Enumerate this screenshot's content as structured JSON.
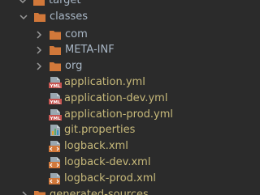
{
  "tree": {
    "target_label": "target",
    "classes_label": "classes",
    "com_label": "com",
    "meta_inf_label": "META-INF",
    "org_label": "org",
    "application_yml": "application.yml",
    "application_dev_yml": "application-dev.yml",
    "application_prod_yml": "application-prod.yml",
    "git_properties": "git.properties",
    "logback_xml": "logback.xml",
    "logback_dev_xml": "logback-dev.xml",
    "logback_prod_xml": "logback-prod.xml",
    "generated_sources_label": "generated-sources",
    "yml_badge": "YML"
  },
  "colors": {
    "background": "#2b2b2b",
    "folder": "#d1783a",
    "text": "#c7b97a",
    "chevron": "#9a9a9a"
  },
  "icons": {
    "chevron_down": "chevron-down-icon",
    "chevron_right": "chevron-right-icon",
    "folder": "folder-icon",
    "yml": "yml-file-icon",
    "properties": "properties-file-icon",
    "xml": "xml-file-icon"
  }
}
